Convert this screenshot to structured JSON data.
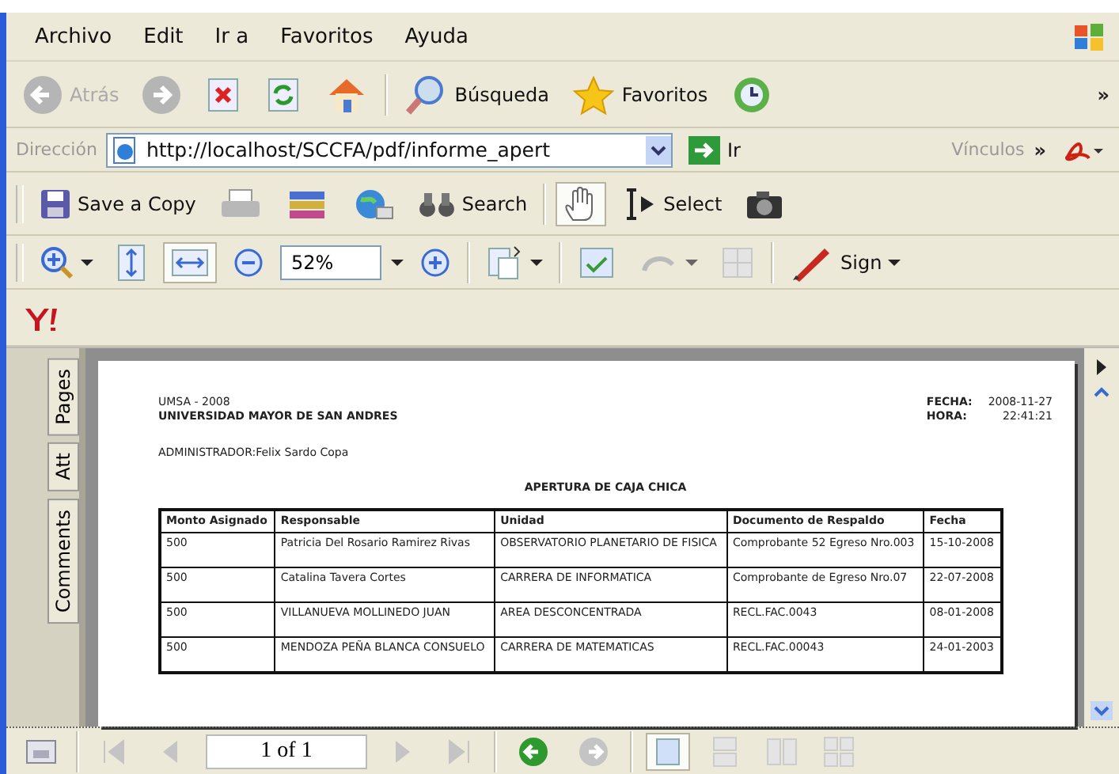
{
  "menu": [
    "Archivo",
    "Edit",
    "Ir a",
    "Favoritos",
    "Ayuda"
  ],
  "nav_toolbar": {
    "back": {
      "label": "Atrás",
      "disabled": true
    },
    "forward": {
      "disabled": true
    },
    "search": "Búsqueda",
    "favorites": "Favoritos",
    "more": "»"
  },
  "address_bar": {
    "label": "Dirección",
    "value": "http://localhost/SCCFA/pdf/informe_apert",
    "go": "Ir",
    "links": "Vínculos",
    "more": "»"
  },
  "acrobat_toolbar": {
    "save": "Save a Copy",
    "search": "Search",
    "hand_tool_selected": true,
    "select": "Select",
    "zoom": "52%",
    "fit_width_selected": true,
    "sign": "Sign"
  },
  "side_tabs": [
    {
      "label": "Pages"
    },
    {
      "label": "Att"
    },
    {
      "label": "Comments"
    }
  ],
  "document": {
    "org_short": "UMSA - 2008",
    "org": "UNIVERSIDAD MAYOR DE SAN ANDRES",
    "date_label": "FECHA:",
    "date": "2008-11-27",
    "time_label": "HORA:",
    "time": "22:41:21",
    "admin": "ADMINISTRADOR:Felix Sardo Copa",
    "title": "APERTURA DE CAJA CHICA",
    "table": {
      "columns": [
        "Monto Asignado",
        "Responsable",
        "Unidad",
        "Documento de Respaldo",
        "Fecha"
      ],
      "rows": [
        [
          "500",
          "Patricia Del Rosario Ramirez Rivas",
          "OBSERVATORIO PLANETARIO DE FISICA",
          "Comprobante 52 Egreso Nro.003",
          "15-10-2008"
        ],
        [
          "500",
          "Catalina Tavera Cortes",
          "CARRERA DE INFORMATICA",
          "Comprobante de Egreso Nro.07",
          "22-07-2008"
        ],
        [
          "500",
          "VILLANUEVA MOLLINEDO JUAN",
          "AREA DESCONCENTRADA",
          "RECL.FAC.0043",
          "08-01-2008"
        ],
        [
          "500",
          "MENDOZA PEÑA BLANCA CONSUELO",
          "CARRERA DE MATEMATICAS",
          "RECL.FAC.00043",
          "24-01-2003"
        ]
      ]
    }
  },
  "status_bar": {
    "page": "1 of 1"
  }
}
